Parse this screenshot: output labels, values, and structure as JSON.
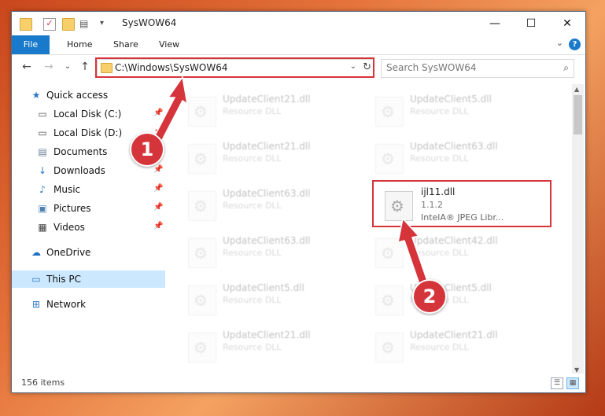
{
  "window": {
    "title": "SysWOW64",
    "minimize": "—",
    "maximize": "☐",
    "close": "✕"
  },
  "ribbon": {
    "tabs": [
      "File",
      "Home",
      "Share",
      "View"
    ],
    "help": "?",
    "collapse": "⌄"
  },
  "nav": {
    "back": "←",
    "forward": "→",
    "recent": "⌄",
    "up": "↑",
    "address": "C:\\Windows\\SysWOW64",
    "address_dropdown": "⌄",
    "refresh": "↻",
    "search_placeholder": "Search SysWOW64"
  },
  "sidebar": {
    "items": [
      {
        "label": "Quick access",
        "icon": "star-icon",
        "glyph": "★",
        "color": "#2b77c9"
      },
      {
        "label": "Local Disk (C:)",
        "icon": "drive-icon",
        "glyph": "▭",
        "color": "#555555",
        "pinned": true
      },
      {
        "label": "Local Disk (D:)",
        "icon": "drive-icon",
        "glyph": "▭",
        "color": "#555555",
        "pinned": true
      },
      {
        "label": "Documents",
        "icon": "documents-icon",
        "glyph": "▤",
        "color": "#6d7f99",
        "pinned": true
      },
      {
        "label": "Downloads",
        "icon": "download-icon",
        "glyph": "↓",
        "color": "#2b77c9",
        "pinned": true
      },
      {
        "label": "Music",
        "icon": "music-icon",
        "glyph": "♪",
        "color": "#2b77c9",
        "pinned": true
      },
      {
        "label": "Pictures",
        "icon": "pictures-icon",
        "glyph": "▣",
        "color": "#4d7fb0",
        "pinned": true
      },
      {
        "label": "Videos",
        "icon": "videos-icon",
        "glyph": "▦",
        "color": "#444444",
        "pinned": true
      },
      {
        "label": "OneDrive",
        "icon": "cloud-icon",
        "glyph": "☁",
        "color": "#1e6fc4"
      },
      {
        "label": "This PC",
        "icon": "computer-icon",
        "glyph": "▭",
        "color": "#2b77c9",
        "selected": true
      },
      {
        "label": "Network",
        "icon": "network-icon",
        "glyph": "⊞",
        "color": "#2b77c9"
      }
    ]
  },
  "files": [
    {
      "name": "UpdateClient21.dll",
      "type": "Resource DLL"
    },
    {
      "name": "UpdateClient5.dll",
      "type": "Resource DLL"
    },
    {
      "name": "UpdateClient21.dll",
      "type": "Resource DLL"
    },
    {
      "name": "UpdateClient63.dll",
      "type": "Resource DLL"
    },
    {
      "name": "UpdateClient63.dll",
      "type": "Resource DLL"
    },
    {
      "name": "ijl11.dll",
      "version": "1.1.2",
      "desc": "IntelA® JPEG Libr...",
      "highlighted": true
    },
    {
      "name": "UpdateClient63.dll",
      "type": "Resource DLL"
    },
    {
      "name": "UpdateClient42.dll",
      "type": "Resource DLL"
    },
    {
      "name": "UpdateClient5.dll",
      "type": "Resource DLL"
    },
    {
      "name": "UpdateClient5.dll",
      "type": "Resource DLL"
    },
    {
      "name": "UpdateClient21.dll",
      "type": "Resource DLL"
    },
    {
      "name": "UpdateClient21.dll",
      "type": "Resource DLL"
    }
  ],
  "status": {
    "count": "156 items"
  },
  "annotations": {
    "step1": "1",
    "step2": "2",
    "color": "#d6343b"
  }
}
